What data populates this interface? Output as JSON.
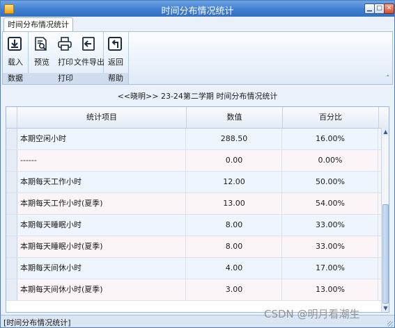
{
  "window": {
    "title": "时间分布情况统计"
  },
  "tab": {
    "label": "时间分布情况统计"
  },
  "ribbon": {
    "groups": [
      {
        "label": "数据",
        "buttons": [
          {
            "label": "载入",
            "icon": "import-icon"
          }
        ]
      },
      {
        "label": "打印",
        "buttons": [
          {
            "label": "预览",
            "icon": "preview-icon"
          },
          {
            "label": "打印",
            "icon": "printer-icon"
          },
          {
            "label": "文件导出",
            "icon": "export-icon"
          }
        ]
      },
      {
        "label": "帮助",
        "buttons": [
          {
            "label": "返回",
            "icon": "return-icon"
          }
        ]
      }
    ]
  },
  "heading": "<<晓明>> 23-24第二学期 时间分布情况统计",
  "table": {
    "columns": [
      "统计项目",
      "数值",
      "百分比"
    ],
    "rows": [
      {
        "item": "本期空闲小时",
        "value": "288.50",
        "percent": "16.00%"
      },
      {
        "item": "------",
        "value": "0.00",
        "percent": "0.00%"
      },
      {
        "item": "本期每天工作小时",
        "value": "12.00",
        "percent": "50.00%"
      },
      {
        "item": "本期每天工作小时(夏季)",
        "value": "13.00",
        "percent": "54.00%"
      },
      {
        "item": "本期每天睡眠小时",
        "value": "8.00",
        "percent": "33.00%"
      },
      {
        "item": "本期每天睡眠小时(夏季)",
        "value": "8.00",
        "percent": "33.00%"
      },
      {
        "item": "本期每天间休小时",
        "value": "4.00",
        "percent": "17.00%"
      },
      {
        "item": "本期每天间休小时(夏季)",
        "value": "3.00",
        "percent": "13.00%"
      }
    ]
  },
  "status": {
    "text": "[时间分布情况统计]"
  },
  "watermark": "CSDN @明月看潮生",
  "colors": {
    "titlebar": "#3f7fd1",
    "row_even": "#eef5fd",
    "row_odd": "#fbf5f8"
  }
}
